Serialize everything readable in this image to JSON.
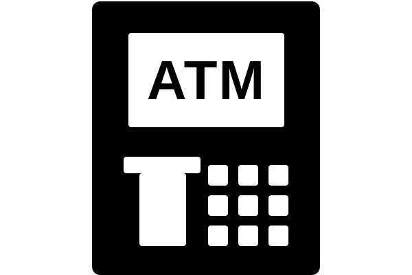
{
  "screen": {
    "label": "ATM"
  },
  "icon": {
    "name": "atm-machine-icon",
    "foreground": "#000000",
    "background": "#ffffff"
  },
  "keypad": {
    "rows": 3,
    "columns": 3
  }
}
